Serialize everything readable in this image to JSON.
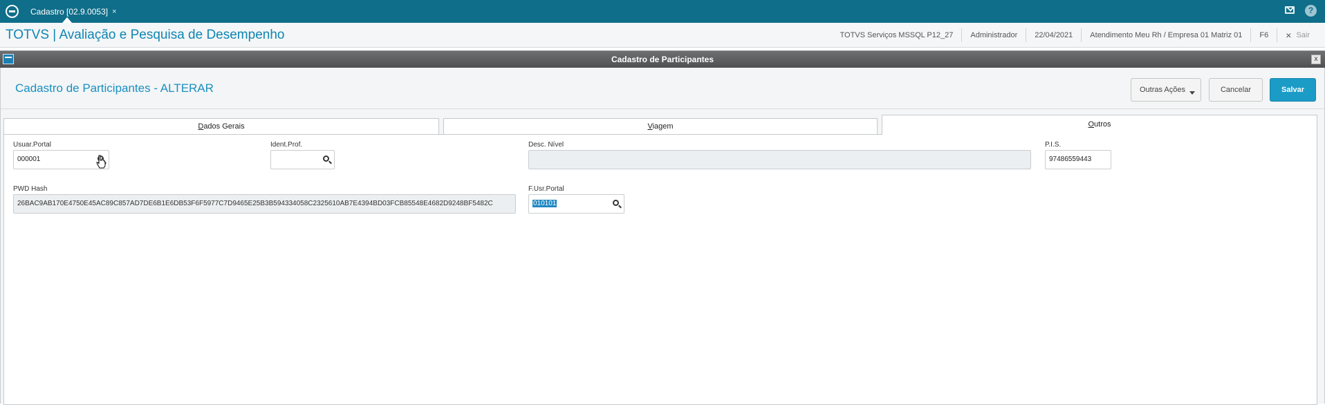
{
  "topbar": {
    "tab_label": "Cadastro [02.9.0053]",
    "tab_close": "×",
    "help_label": "?"
  },
  "titlebar": {
    "app_title": "TOTVS | Avaliação e Pesquisa de Desempenho",
    "environment": "TOTVS Serviços MSSQL P12_27",
    "user": "Administrador",
    "date": "22/04/2021",
    "company": "Atendimento Meu Rh / Empresa 01 Matriz 01",
    "shortcut": "F6",
    "exit_icon": "×",
    "exit_label": "Sair"
  },
  "dialog": {
    "window_title": "Cadastro de Participantes",
    "close_label": "x",
    "form_title": "Cadastro de Participantes - ALTERAR"
  },
  "actions": {
    "other_label": "Outras Ações",
    "cancel_label": "Cancelar",
    "save_label": "Salvar"
  },
  "tabs": [
    {
      "first": "D",
      "rest": "ados Gerais"
    },
    {
      "first": "V",
      "rest": "iagem"
    },
    {
      "first": "O",
      "rest": "utros",
      "active": true
    }
  ],
  "fields": {
    "usuar_portal": {
      "label": "Usuar.Portal",
      "value": "000001"
    },
    "ident_prof": {
      "label": "Ident.Prof.",
      "value": ""
    },
    "desc_nivel": {
      "label": "Desc. Nível",
      "value": ""
    },
    "pis": {
      "label": "P.I.S.",
      "value": "97486559443"
    },
    "pwd_hash": {
      "label": "PWD Hash",
      "value": "26BAC9AB170E4750E45AC89C857AD7DE6B1E6DB53F6F5977C7D9465E25B3B594334058C2325610AB7E4394BD03FCB85548E4682D9248BF5482C"
    },
    "f_usr_portal": {
      "label": "F.Usr.Portal",
      "value": "010101"
    }
  },
  "colors": {
    "topbar": "#0f6e89",
    "accent": "#1a9cc7",
    "title_text": "#0f85b3"
  },
  "icons": [
    "totvs-logo-icon",
    "mail-icon",
    "help-icon",
    "window-icon",
    "close-icon",
    "search-icon",
    "pointer-cursor-icon"
  ]
}
